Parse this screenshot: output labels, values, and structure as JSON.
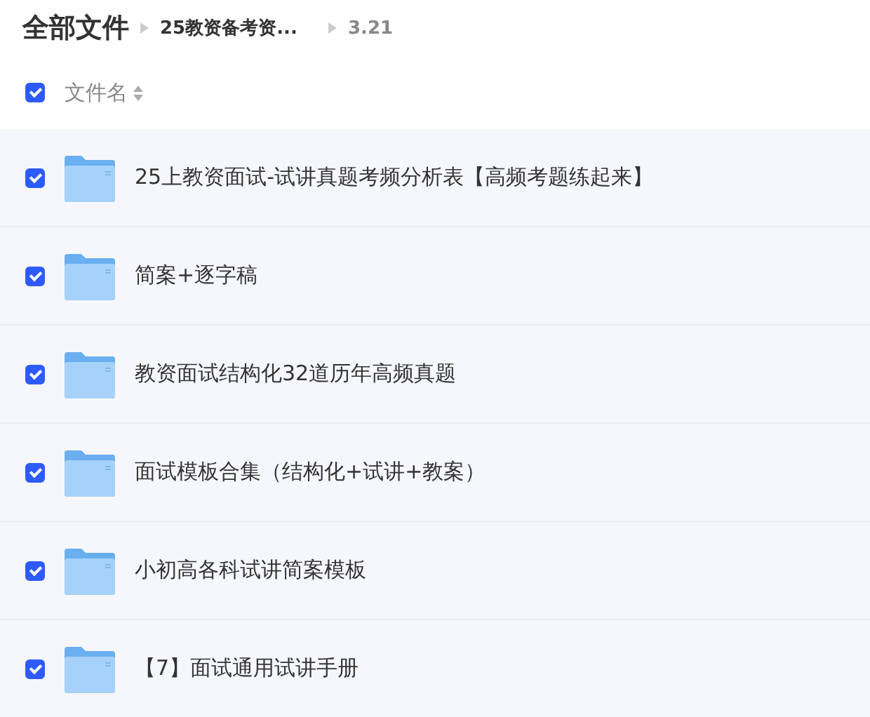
{
  "breadcrumb": [
    {
      "label": "全部文件",
      "kind": "root"
    },
    {
      "label": "25教资备考资...",
      "kind": "folder"
    },
    {
      "label": "3.21",
      "kind": "current"
    }
  ],
  "header": {
    "label": "文件名",
    "checked": true
  },
  "files": [
    {
      "name": "25上教资面试-试讲真题考频分析表【高频考题练起来】",
      "checked": true
    },
    {
      "name": "简案+逐字稿",
      "checked": true
    },
    {
      "name": "教资面试结构化32道历年高频真题",
      "checked": true
    },
    {
      "name": "面试模板合集（结构化+试讲+教案）",
      "checked": true
    },
    {
      "name": "小初高各科试讲简案模板",
      "checked": true
    },
    {
      "name": "【7】面试通用试讲手册",
      "checked": true
    }
  ]
}
